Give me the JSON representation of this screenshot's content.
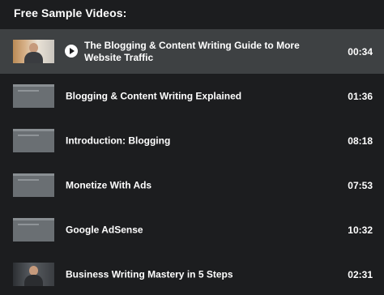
{
  "heading": "Free Sample Videos:",
  "videos": [
    {
      "title": "The Blogging & Content Writing Guide to More Website Traffic",
      "duration": "00:34",
      "active": true,
      "thumb": "presenter"
    },
    {
      "title": "Blogging & Content Writing Explained",
      "duration": "01:36",
      "active": false,
      "thumb": "slide"
    },
    {
      "title": "Introduction: Blogging",
      "duration": "08:18",
      "active": false,
      "thumb": "slide"
    },
    {
      "title": "Monetize With Ads",
      "duration": "07:53",
      "active": false,
      "thumb": "slide"
    },
    {
      "title": "Google AdSense",
      "duration": "10:32",
      "active": false,
      "thumb": "slide"
    },
    {
      "title": "Business Writing Mastery in 5 Steps",
      "duration": "02:31",
      "active": false,
      "thumb": "presenter-dark"
    }
  ],
  "icons": {
    "play": "play-icon"
  },
  "colors": {
    "background": "#1c1d1f",
    "active_row": "#3e4143",
    "text": "#ffffff"
  }
}
